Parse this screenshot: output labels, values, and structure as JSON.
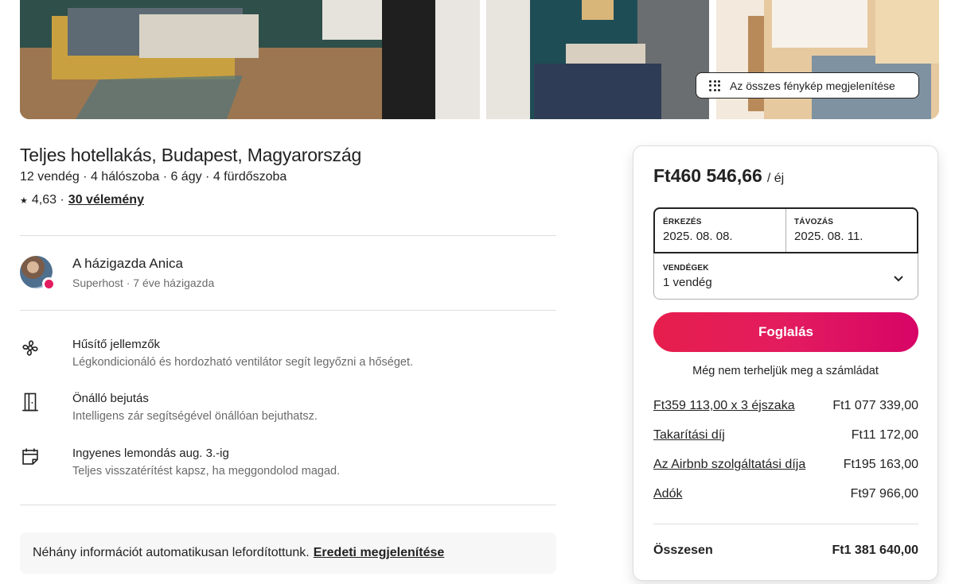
{
  "photos": {
    "show_all_label": "Az összes fénykép megjelenítése"
  },
  "listing": {
    "title": "Teljes hotellakás, Budapest, Magyarország",
    "subtitle": "12 vendég · 4 hálószoba · 6 ágy · 4 fürdőszoba",
    "star": "★",
    "rating": "4,63 ·",
    "reviews": "30 vélemény"
  },
  "host": {
    "name": "A házigazda Anica",
    "meta": "Superhost · 7 éve házigazda"
  },
  "features": [
    {
      "icon": "fan-icon",
      "title": "Hűsítő jellemzők",
      "desc": "Légkondicionáló és hordozható ventilátor segít legyőzni a hőséget."
    },
    {
      "icon": "door-icon",
      "title": "Önálló bejutás",
      "desc": "Intelligens zár segítségével önállóan bejuthatsz."
    },
    {
      "icon": "calendar-icon",
      "title": "Ingyenes lemondás aug. 3.-ig",
      "desc": "Teljes visszatérítést kapsz, ha meggondolod magad."
    }
  ],
  "translation": {
    "text": "Néhány információt automatikusan lefordítottunk.",
    "link": "Eredeti megjelenítése"
  },
  "booking": {
    "price": "Ft460 546,66",
    "per": "/ éj",
    "checkin_label": "ÉRKEZÉS",
    "checkin_value": "2025. 08. 08.",
    "checkout_label": "TÁVOZÁS",
    "checkout_value": "2025. 08. 11.",
    "guests_label": "VENDÉGEK",
    "guests_value": "1 vendég",
    "book_label": "Foglalás",
    "no_charge": "Még nem terheljük meg a számládat",
    "lines": [
      {
        "label": "Ft359 113,00 x 3 éjszaka",
        "amount": "Ft1 077 339,00"
      },
      {
        "label": "Takarítási díj",
        "amount": "Ft11 172,00"
      },
      {
        "label": "Az Airbnb szolgáltatási díja",
        "amount": "Ft195 163,00"
      },
      {
        "label": "Adók",
        "amount": "Ft97 966,00"
      }
    ],
    "total_label": "Összesen",
    "total_amount": "Ft1 381 640,00"
  }
}
